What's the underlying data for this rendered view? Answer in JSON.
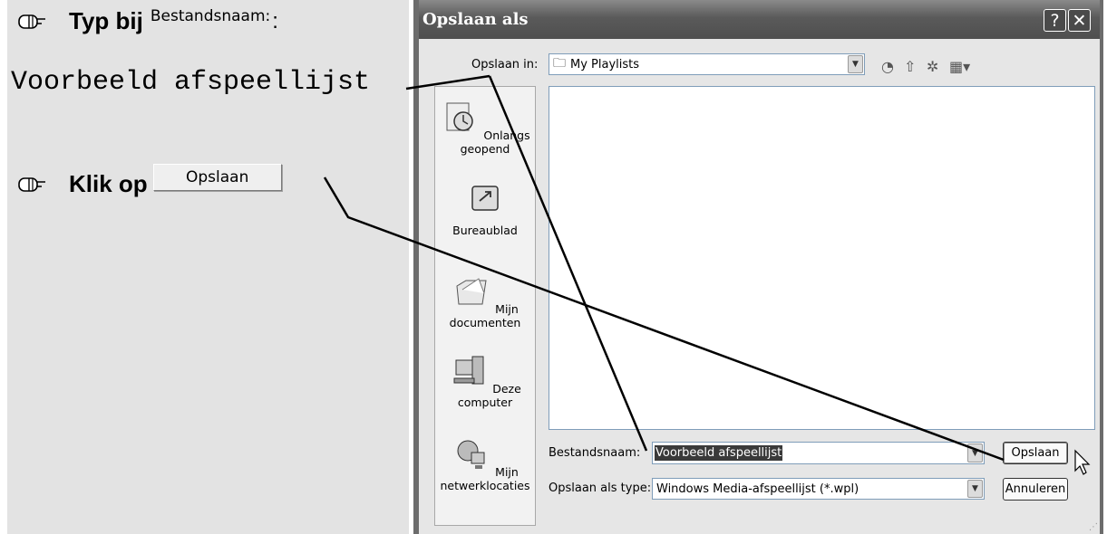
{
  "instructions": {
    "step1": {
      "action": "Typ bij",
      "field_label": "Bestandsnaam:",
      "colon": ":"
    },
    "typed_value": "Voorbeeld afspeellijst",
    "step2": {
      "action": "Klik op",
      "button_label": "Opslaan"
    },
    "hand_icon": "pointing-hand-icon"
  },
  "dialog": {
    "title": "Opslaan als",
    "help_glyph": "?",
    "close_glyph": "✕",
    "save_in_label": "Opslaan in:",
    "save_in_value": "My Playlists",
    "toolbar": [
      "back-icon",
      "up-folder-icon",
      "new-folder-icon",
      "views-menu-icon"
    ],
    "places": [
      {
        "label": "Onlangs geopend",
        "icon": "recent-icon"
      },
      {
        "label": "Bureaublad",
        "icon": "desktop-icon"
      },
      {
        "label": "Mijn documenten",
        "icon": "my-documents-icon"
      },
      {
        "label": "Deze computer",
        "icon": "my-computer-icon"
      },
      {
        "label": "Mijn netwerklocaties",
        "icon": "network-places-icon"
      }
    ],
    "filename_label": "Bestandsnaam:",
    "filename_value": "Voorbeeld afspeellijst",
    "filetype_label": "Opslaan als type:",
    "filetype_value": "Windows Media-afspeellijst (*.wpl)",
    "save_button": "Opslaan",
    "cancel_button": "Annuleren"
  }
}
